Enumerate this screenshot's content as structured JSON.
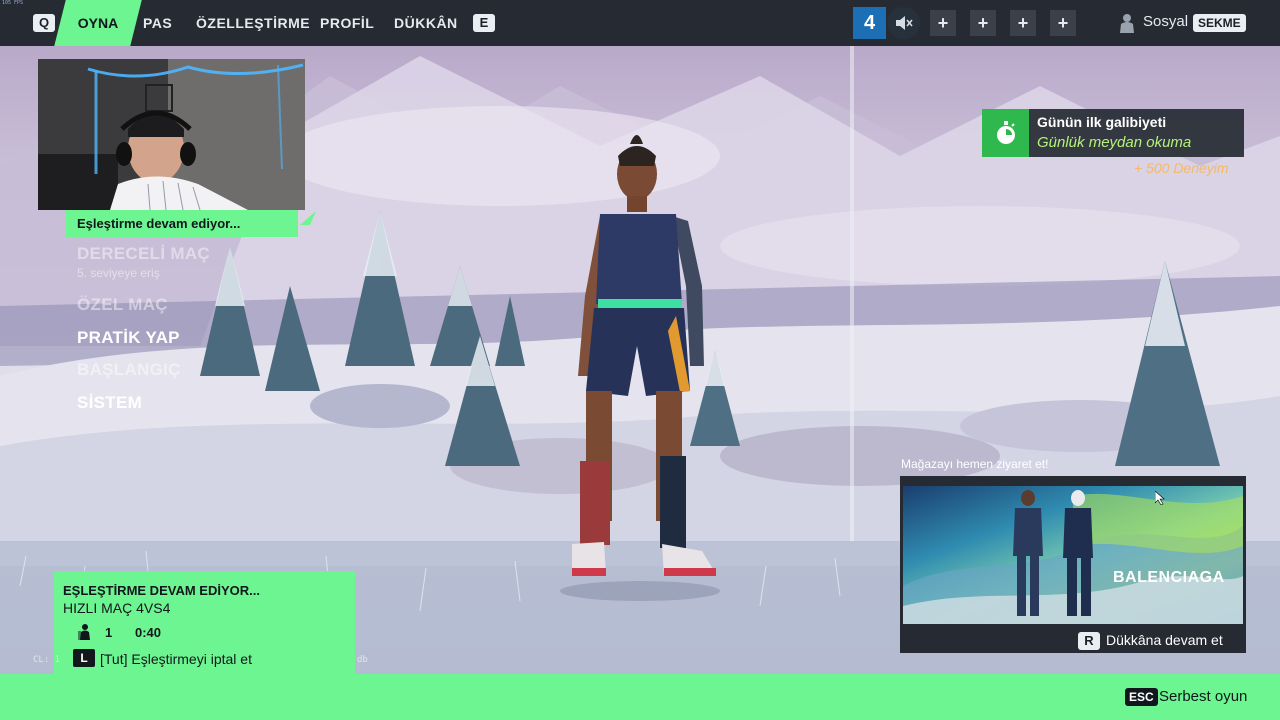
{
  "hud": {
    "fps_text": "105 FPS"
  },
  "nav": {
    "left_key": "Q",
    "right_key": "E",
    "tabs": [
      {
        "label": "OYNA",
        "active": true
      },
      {
        "label": "PAS",
        "active": false
      },
      {
        "label": "ÖZELLEŞTİRME",
        "active": false
      },
      {
        "label": "PROFİL",
        "active": false
      },
      {
        "label": "DÜKKÂN",
        "active": false
      }
    ]
  },
  "party": {
    "count": "4",
    "slot_label": "+"
  },
  "social": {
    "label": "Sosyal",
    "key": "SEKME"
  },
  "play_menu": {
    "status": "Eşleştirme devam ediyor...",
    "items": [
      {
        "label": "DERECELİ MAÇ",
        "sub": "5. seviyeye eriş",
        "enabled": false
      },
      {
        "label": "ÖZEL MAÇ",
        "enabled": false
      },
      {
        "label": "PRATİK YAP",
        "enabled": true
      },
      {
        "label": "BAŞLANGIÇ",
        "enabled": false
      },
      {
        "label": "SİSTEM",
        "enabled": true
      }
    ]
  },
  "daily_challenge": {
    "title": "Günün ilk galibiyeti",
    "subtitle": "Günlük meydan okuma",
    "reward": "+ 500 Deneyim"
  },
  "store_promo": {
    "caption": "Mağazayı hemen ziyaret et!",
    "brand": "BALENCIAGA",
    "key": "R",
    "action": "Dükkâna devam et"
  },
  "matchmaking": {
    "title": "EŞLEŞTİRME DEVAM EDİYOR...",
    "mode": "HIZLI MAÇ 4VS4",
    "players": "1",
    "timer": "0:40",
    "cancel_key": "L",
    "cancel_label": "[Tut] Eşleştirmeyi iptal et"
  },
  "footer": {
    "key": "ESC",
    "label": "Serbest oyun",
    "cl_prefix": "CL: 1",
    "cl_suffix": "db"
  },
  "colors": {
    "accent_green": "#6cf590",
    "topbar": "#262b33",
    "party_blue": "#1d6fb5",
    "reward_orange": "#f4b96a",
    "challenge_green": "#2fb84e"
  }
}
